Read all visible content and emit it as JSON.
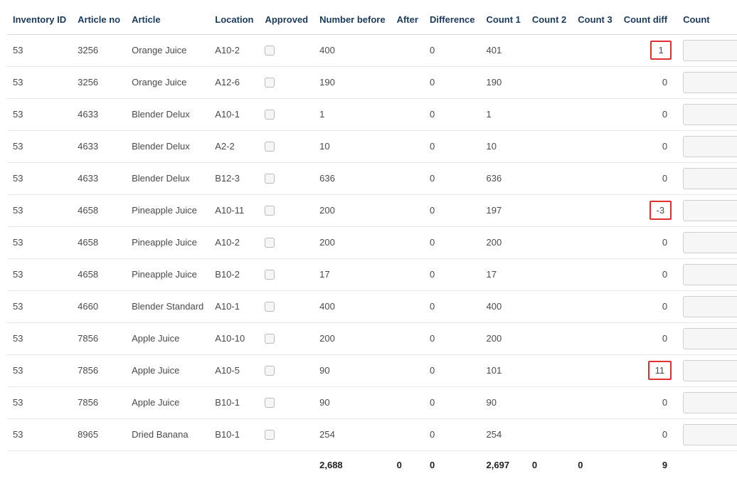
{
  "headers": {
    "inventory_id": "Inventory ID",
    "article_no": "Article no",
    "article": "Article",
    "location": "Location",
    "approved": "Approved",
    "number_before": "Number before",
    "after": "After",
    "difference": "Difference",
    "count1": "Count 1",
    "count2": "Count 2",
    "count3": "Count 3",
    "count_diff": "Count diff",
    "count": "Count"
  },
  "rows": [
    {
      "inv": "53",
      "ano": "3256",
      "art": "Orange Juice",
      "loc": "A10-2",
      "nb": "400",
      "aft": "",
      "dif": "0",
      "c1": "401",
      "c2": "",
      "c3": "",
      "cd": "1",
      "hl": true
    },
    {
      "inv": "53",
      "ano": "3256",
      "art": "Orange Juice",
      "loc": "A12-6",
      "nb": "190",
      "aft": "",
      "dif": "0",
      "c1": "190",
      "c2": "",
      "c3": "",
      "cd": "0",
      "hl": false
    },
    {
      "inv": "53",
      "ano": "4633",
      "art": "Blender Delux",
      "loc": "A10-1",
      "nb": "1",
      "aft": "",
      "dif": "0",
      "c1": "1",
      "c2": "",
      "c3": "",
      "cd": "0",
      "hl": false
    },
    {
      "inv": "53",
      "ano": "4633",
      "art": "Blender Delux",
      "loc": "A2-2",
      "nb": "10",
      "aft": "",
      "dif": "0",
      "c1": "10",
      "c2": "",
      "c3": "",
      "cd": "0",
      "hl": false
    },
    {
      "inv": "53",
      "ano": "4633",
      "art": "Blender Delux",
      "loc": "B12-3",
      "nb": "636",
      "aft": "",
      "dif": "0",
      "c1": "636",
      "c2": "",
      "c3": "",
      "cd": "0",
      "hl": false
    },
    {
      "inv": "53",
      "ano": "4658",
      "art": "Pineapple Juice",
      "loc": "A10-11",
      "nb": "200",
      "aft": "",
      "dif": "0",
      "c1": "197",
      "c2": "",
      "c3": "",
      "cd": "-3",
      "hl": true
    },
    {
      "inv": "53",
      "ano": "4658",
      "art": "Pineapple Juice",
      "loc": "A10-2",
      "nb": "200",
      "aft": "",
      "dif": "0",
      "c1": "200",
      "c2": "",
      "c3": "",
      "cd": "0",
      "hl": false
    },
    {
      "inv": "53",
      "ano": "4658",
      "art": "Pineapple Juice",
      "loc": "B10-2",
      "nb": "17",
      "aft": "",
      "dif": "0",
      "c1": "17",
      "c2": "",
      "c3": "",
      "cd": "0",
      "hl": false
    },
    {
      "inv": "53",
      "ano": "4660",
      "art": "Blender Standard",
      "loc": "A10-1",
      "nb": "400",
      "aft": "",
      "dif": "0",
      "c1": "400",
      "c2": "",
      "c3": "",
      "cd": "0",
      "hl": false
    },
    {
      "inv": "53",
      "ano": "7856",
      "art": "Apple Juice",
      "loc": "A10-10",
      "nb": "200",
      "aft": "",
      "dif": "0",
      "c1": "200",
      "c2": "",
      "c3": "",
      "cd": "0",
      "hl": false
    },
    {
      "inv": "53",
      "ano": "7856",
      "art": "Apple Juice",
      "loc": "A10-5",
      "nb": "90",
      "aft": "",
      "dif": "0",
      "c1": "101",
      "c2": "",
      "c3": "",
      "cd": "11",
      "hl": true
    },
    {
      "inv": "53",
      "ano": "7856",
      "art": "Apple Juice",
      "loc": "B10-1",
      "nb": "90",
      "aft": "",
      "dif": "0",
      "c1": "90",
      "c2": "",
      "c3": "",
      "cd": "0",
      "hl": false
    },
    {
      "inv": "53",
      "ano": "8965",
      "art": "Dried Banana",
      "loc": "B10-1",
      "nb": "254",
      "aft": "",
      "dif": "0",
      "c1": "254",
      "c2": "",
      "c3": "",
      "cd": "0",
      "hl": false
    }
  ],
  "footer": {
    "nb": "2,688",
    "aft": "0",
    "dif": "0",
    "c1": "2,697",
    "c2": "0",
    "c3": "0",
    "cd": "9"
  }
}
